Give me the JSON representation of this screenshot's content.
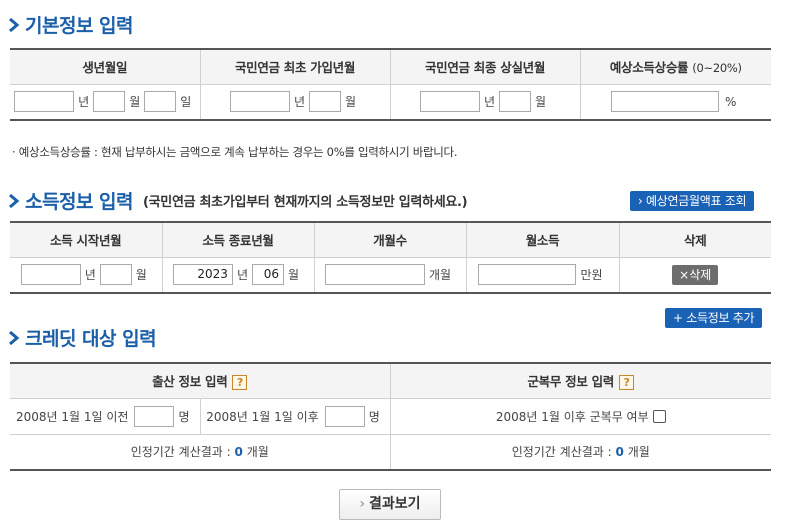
{
  "basic": {
    "title": "기본정보 입력",
    "headers": [
      "생년월일",
      "국민연금 최초 가입년월",
      "국민연금 최종 상실년월",
      "예상소득상승률"
    ],
    "rate_range": "(0~20%)",
    "units": {
      "year": "년",
      "month": "월",
      "day": "일",
      "percent": "%"
    },
    "note": "· 예상소득상승률 : 현재 납부하시는 금액으로 계속 납부하는 경우는 0%를 입력하시기 바랍니다."
  },
  "income": {
    "title": "소득정보 입력",
    "subtitle": "(국민연금 최초가입부터 현재까지의 소득정보만 입력하세요.)",
    "lookup_button": "› 예상연금월액표 조회",
    "headers": [
      "소득 시작년월",
      "소득 종료년월",
      "개월수",
      "월소득",
      "삭제"
    ],
    "row": {
      "end_year": "2023",
      "end_month": "06"
    },
    "units": {
      "year": "년",
      "month": "월",
      "months": "개월",
      "manwon": "만원"
    },
    "delete_button": "×삭제",
    "add_button": "+ 소득정보 추가"
  },
  "credit": {
    "title": "크레딧 대상 입력",
    "birth_header": "출산 정보 입력",
    "military_header": "군복무 정보 입력",
    "help_glyph": "?",
    "before_label": "2008년 1월 1일 이전",
    "after_label": "2008년 1월 1일 이후",
    "person_unit": "명",
    "military_label": "2008년 1월 이후 군복무 여부",
    "result_prefix": "인정기간 계산결과 :",
    "result_value": "0",
    "result_unit": "개월"
  },
  "result_button": "결과보기"
}
